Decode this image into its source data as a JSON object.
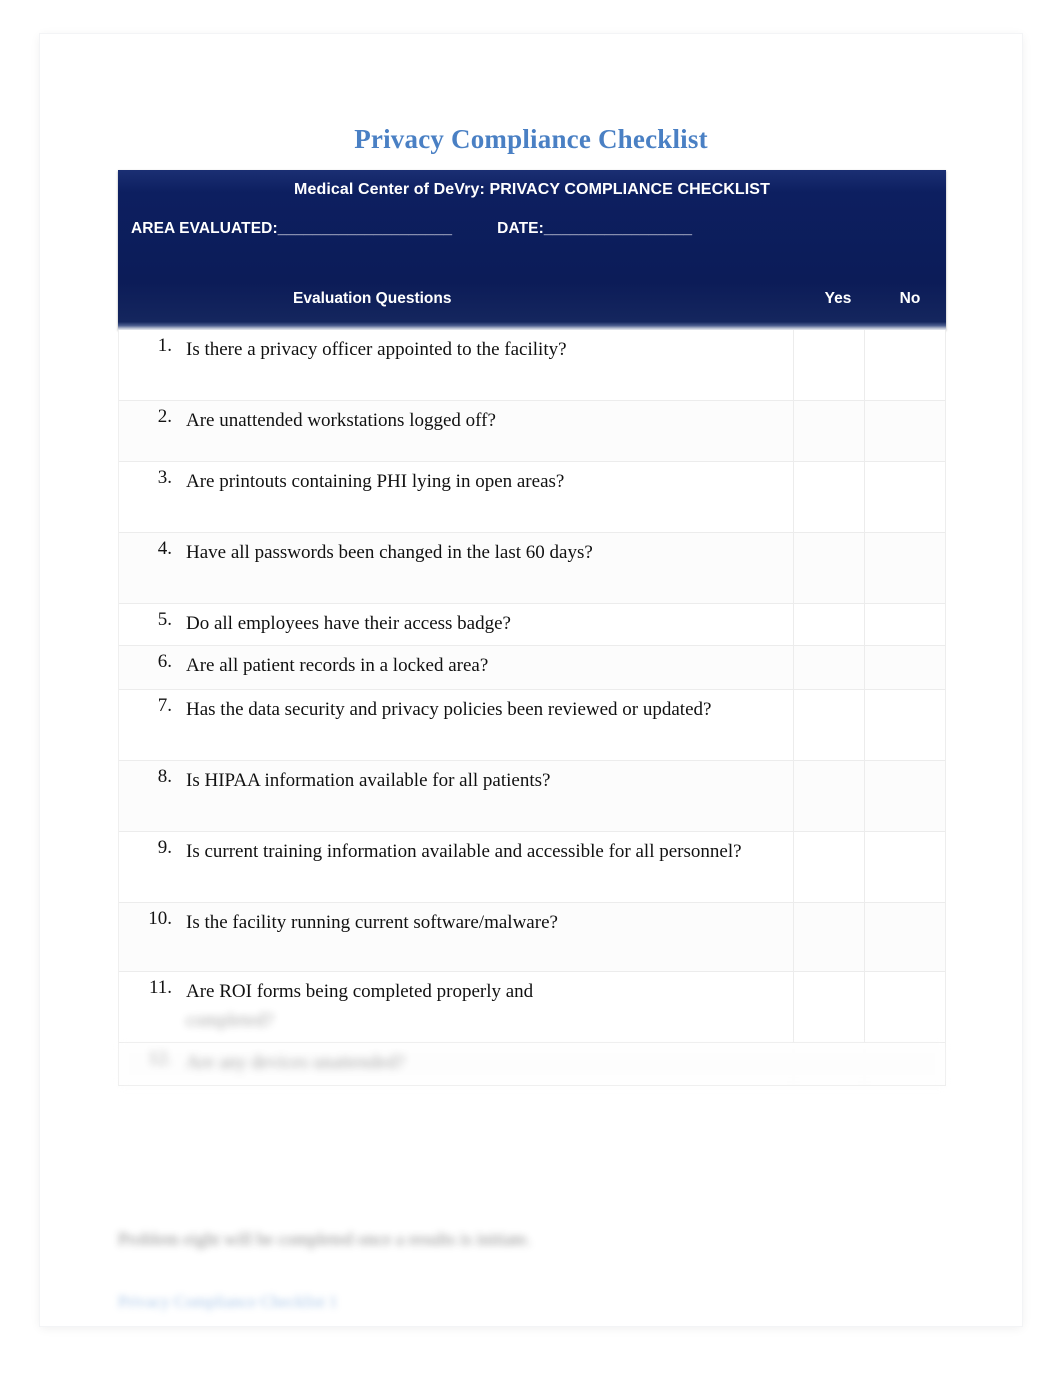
{
  "document": {
    "title": "Privacy Compliance Checklist"
  },
  "header": {
    "org_title": "Medical Center of DeVry: PRIVACY COMPLIANCE CHECKLIST",
    "area_label": "AREA EVALUATED:",
    "area_blank": "____________________",
    "date_label": "DATE:",
    "date_blank": "_________________",
    "col_questions": "Evaluation Questions",
    "col_yes": "Yes",
    "col_no": "No",
    "navy_color": "#0e2063",
    "title_color": "#4a80c4"
  },
  "table": {
    "rows": [
      {
        "num": "1.",
        "question": "Is there a privacy officer appointed to the facility?",
        "yes": "",
        "no": "",
        "obscured": false
      },
      {
        "num": "2.",
        "question": "Are unattended workstations logged off?",
        "yes": "",
        "no": "",
        "obscured": false
      },
      {
        "num": "3.",
        "question": "Are printouts containing PHI lying in open areas?",
        "yes": "",
        "no": "",
        "obscured": false
      },
      {
        "num": "4.",
        "question": "Have all passwords been changed in the last 60 days?",
        "yes": "",
        "no": "",
        "obscured": false
      },
      {
        "num": "5.",
        "question": "Do all employees have their access badge?",
        "yes": "",
        "no": "",
        "obscured": false
      },
      {
        "num": "6.",
        "question": "Are all patient records in a locked area?",
        "yes": "",
        "no": "",
        "obscured": false
      },
      {
        "num": "7.",
        "question": "Has the data security and privacy policies been reviewed or updated?",
        "yes": "",
        "no": "",
        "obscured": false
      },
      {
        "num": "8.",
        "question": "Is HIPAA information available for all patients?",
        "yes": "",
        "no": "",
        "obscured": false
      },
      {
        "num": "9.",
        "question": "Is current training information available and accessible for all personnel?",
        "yes": "",
        "no": "",
        "obscured": false
      },
      {
        "num": "10.",
        "question": "Is the facility running current software/malware?",
        "yes": "",
        "no": "",
        "obscured": false
      },
      {
        "num": "11.",
        "question": "Are ROI forms being completed properly and",
        "question_obscured": "completed?",
        "yes": "",
        "no": "",
        "obscured": false
      },
      {
        "num": "12.",
        "question": "Are any devices unattended?",
        "yes": "",
        "no": "",
        "obscured": true
      }
    ]
  },
  "footer": {
    "note": "Problem eight will be completed once a results is initiate.",
    "link": "Privacy Compliance Checklist 1"
  }
}
